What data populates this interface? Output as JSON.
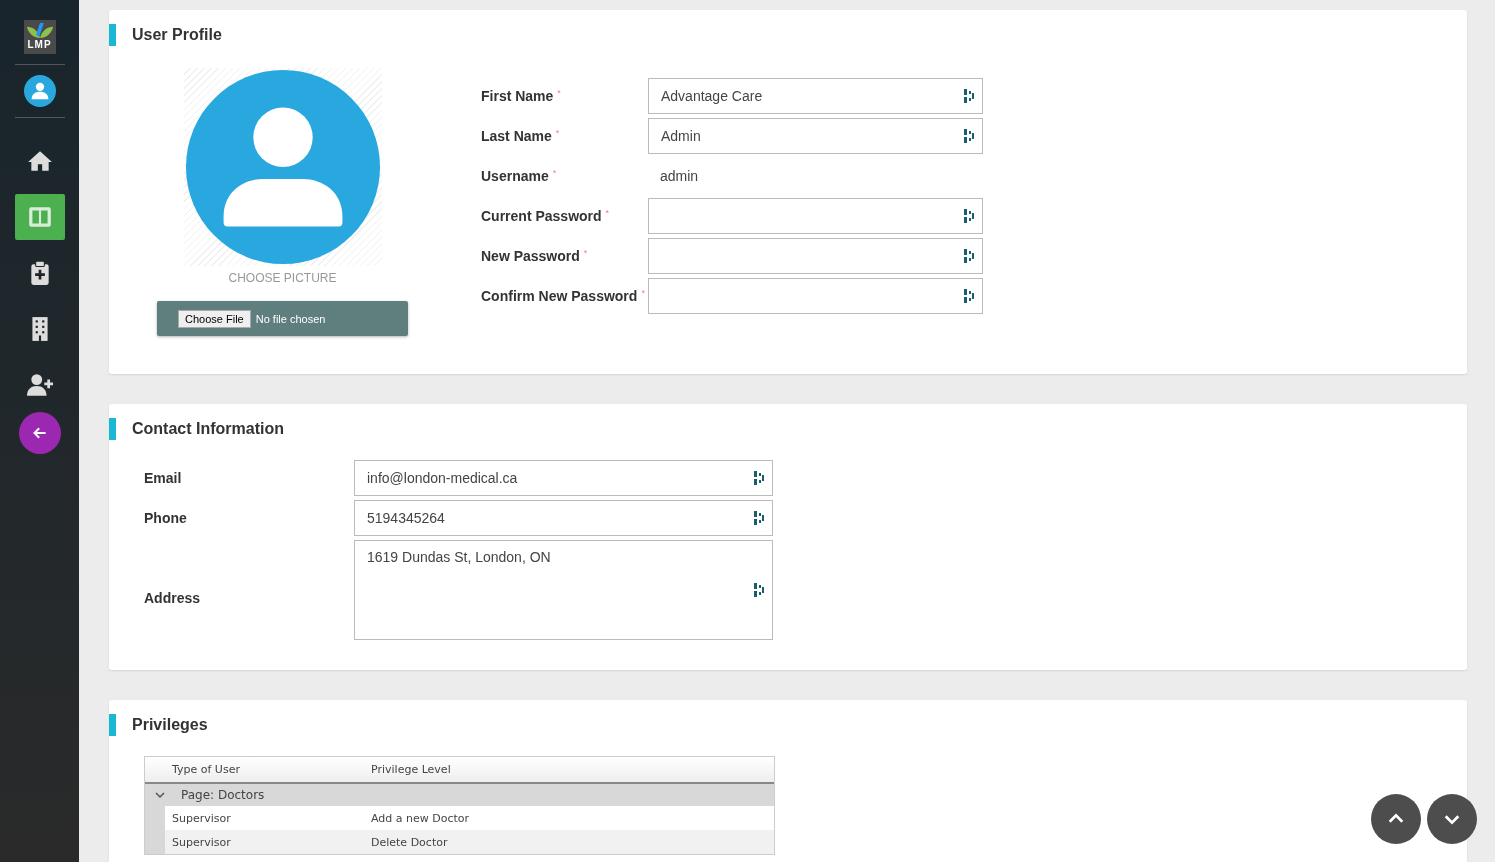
{
  "sidebar": {
    "logo": "LMP",
    "items": [
      {
        "kind": "home",
        "selected": false
      },
      {
        "kind": "dashboard",
        "selected": true
      },
      {
        "kind": "clipboard",
        "selected": false
      },
      {
        "kind": "building",
        "selected": false
      },
      {
        "kind": "add-user",
        "selected": false
      }
    ]
  },
  "user_profile": {
    "title": "User Profile",
    "picture_label": "CHOOSE PICTURE",
    "file_button": "Choose File",
    "file_status": "No file chosen",
    "fields": [
      {
        "kind": "input",
        "label": "First Name",
        "required_mark": "*",
        "value": "Advantage Care"
      },
      {
        "kind": "input",
        "label": "Last Name",
        "required_mark": "*",
        "value": "Admin"
      },
      {
        "kind": "static",
        "label": "Username",
        "required_mark": "*",
        "value": "admin"
      },
      {
        "kind": "input",
        "label": "Current Password",
        "required_mark": "*"
      },
      {
        "kind": "input",
        "label": "New Password",
        "required_mark": "*"
      },
      {
        "kind": "input",
        "label": "Confirm New Password",
        "required_mark": "*"
      }
    ]
  },
  "contact_information": {
    "title": "Contact Information",
    "fields": [
      {
        "kind": "input",
        "label": "Email",
        "value": "info@london-medical.ca"
      },
      {
        "kind": "input",
        "label": "Phone",
        "value": "5194345264"
      },
      {
        "kind": "textarea",
        "label": "Address",
        "value": "1619 Dundas St, London, ON"
      }
    ]
  },
  "privileges": {
    "title": "Privileges",
    "columns": [
      "Type of User",
      "Privilege Level"
    ],
    "groups": [
      {
        "label": "Page: Doctors",
        "expanded": true,
        "rows": [
          [
            "Supervisor",
            "Add a new Doctor"
          ],
          [
            "Supervisor",
            "Delete Doctor"
          ]
        ]
      }
    ]
  }
}
